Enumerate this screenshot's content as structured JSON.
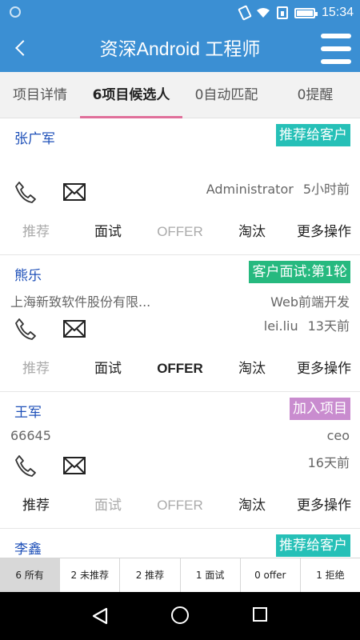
{
  "status_bar": {
    "time": "15:34"
  },
  "header": {
    "title": "资深Android 工程师",
    "colors": {
      "bar": "#3b8fd3",
      "text": "#ffffff"
    }
  },
  "tabs": [
    {
      "label": "项目详情",
      "active": false
    },
    {
      "label": "6项目候选人",
      "active": true
    },
    {
      "label": "0自动匹配",
      "active": false
    },
    {
      "label": "0提醒",
      "active": false
    }
  ],
  "candidates": [
    {
      "name": "张广军",
      "status": "推荐给客户",
      "status_color": "#26c0b7",
      "company": "",
      "position": "",
      "owner": "Administrator",
      "time": "5小时前",
      "actions": [
        {
          "label": "推荐",
          "enabled": false
        },
        {
          "label": "面试",
          "enabled": true
        },
        {
          "label": "OFFER",
          "enabled": false
        },
        {
          "label": "淘汰",
          "enabled": true
        },
        {
          "label": "更多操作",
          "enabled": true
        }
      ]
    },
    {
      "name": "熊乐",
      "status": "客户面试:第1轮",
      "status_color": "#26b97f",
      "company": "上海新致软件股份有限...",
      "position": "Web前端开发",
      "owner": "lei.liu",
      "time": "13天前",
      "actions": [
        {
          "label": "推荐",
          "enabled": false
        },
        {
          "label": "面试",
          "enabled": true
        },
        {
          "label": "OFFER",
          "enabled": true
        },
        {
          "label": "淘汰",
          "enabled": true
        },
        {
          "label": "更多操作",
          "enabled": true
        }
      ]
    },
    {
      "name": "王军",
      "status": "加入项目",
      "status_color": "#c98ccf",
      "company": "66645",
      "position": "ceo",
      "owner": "",
      "time": "16天前",
      "actions": [
        {
          "label": "推荐",
          "enabled": true
        },
        {
          "label": "面试",
          "enabled": false
        },
        {
          "label": "OFFER",
          "enabled": false
        },
        {
          "label": "淘汰",
          "enabled": true
        },
        {
          "label": "更多操作",
          "enabled": true
        }
      ]
    },
    {
      "name": "李鑫",
      "status": "推荐给客户",
      "status_color": "#26c0b7"
    }
  ],
  "filters": [
    {
      "label": "6 所有",
      "selected": true
    },
    {
      "label": "2 未推荐",
      "selected": false
    },
    {
      "label": "2 推荐",
      "selected": false
    },
    {
      "label": "1 面试",
      "selected": false
    },
    {
      "label": "0 offer",
      "selected": false
    },
    {
      "label": "1 拒绝",
      "selected": false
    }
  ]
}
